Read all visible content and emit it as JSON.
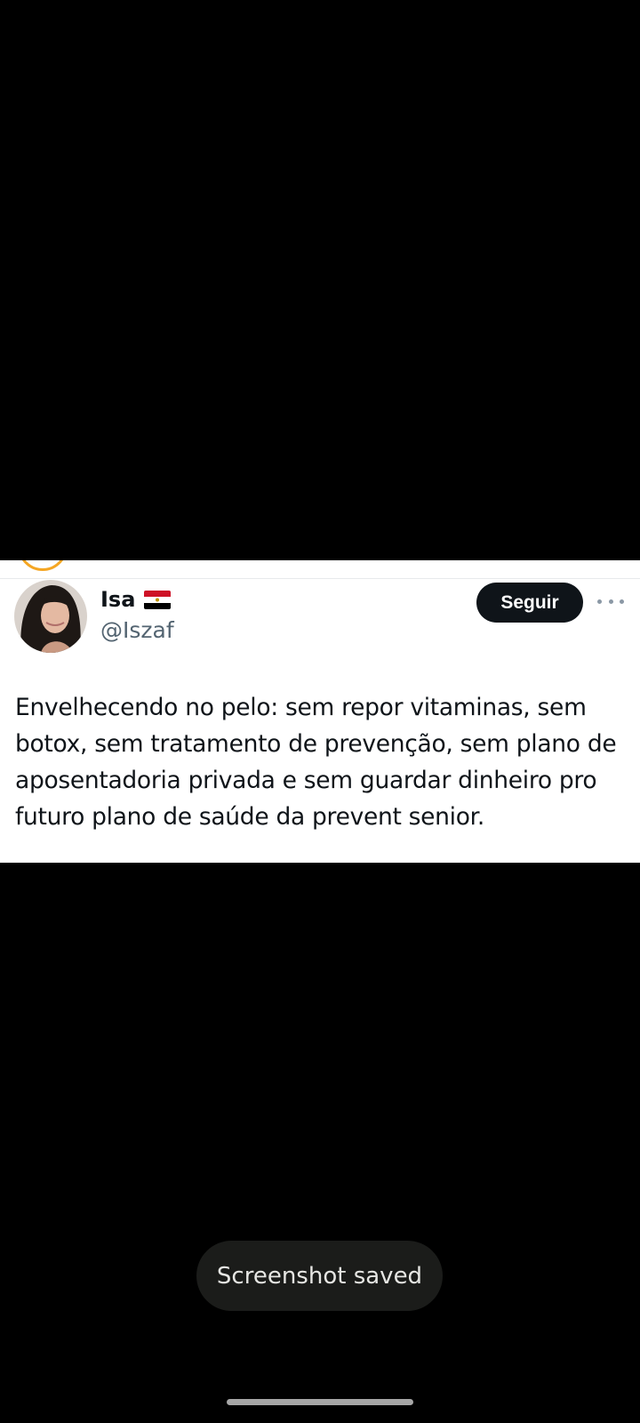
{
  "tweet": {
    "display_name": "Isa",
    "flag_icon": "egypt-flag-icon",
    "handle": "@Iszaf",
    "follow_label": "Seguir",
    "more_icon": "more-options-icon",
    "text": "Envelhecendo no pelo: sem repor vitaminas, sem botox, sem tratamento de prevenção, sem plano de aposentadoria privada e sem guardar dinheiro pro futuro plano de saúde da prevent senior."
  },
  "toast": {
    "message": "Screenshot saved"
  },
  "colors": {
    "background": "#000000",
    "card": "#ffffff",
    "primary_text": "#0f1419",
    "secondary_text": "#536471",
    "follow_button_bg": "#0f1419",
    "toast_bg": "#1b1c1a"
  }
}
